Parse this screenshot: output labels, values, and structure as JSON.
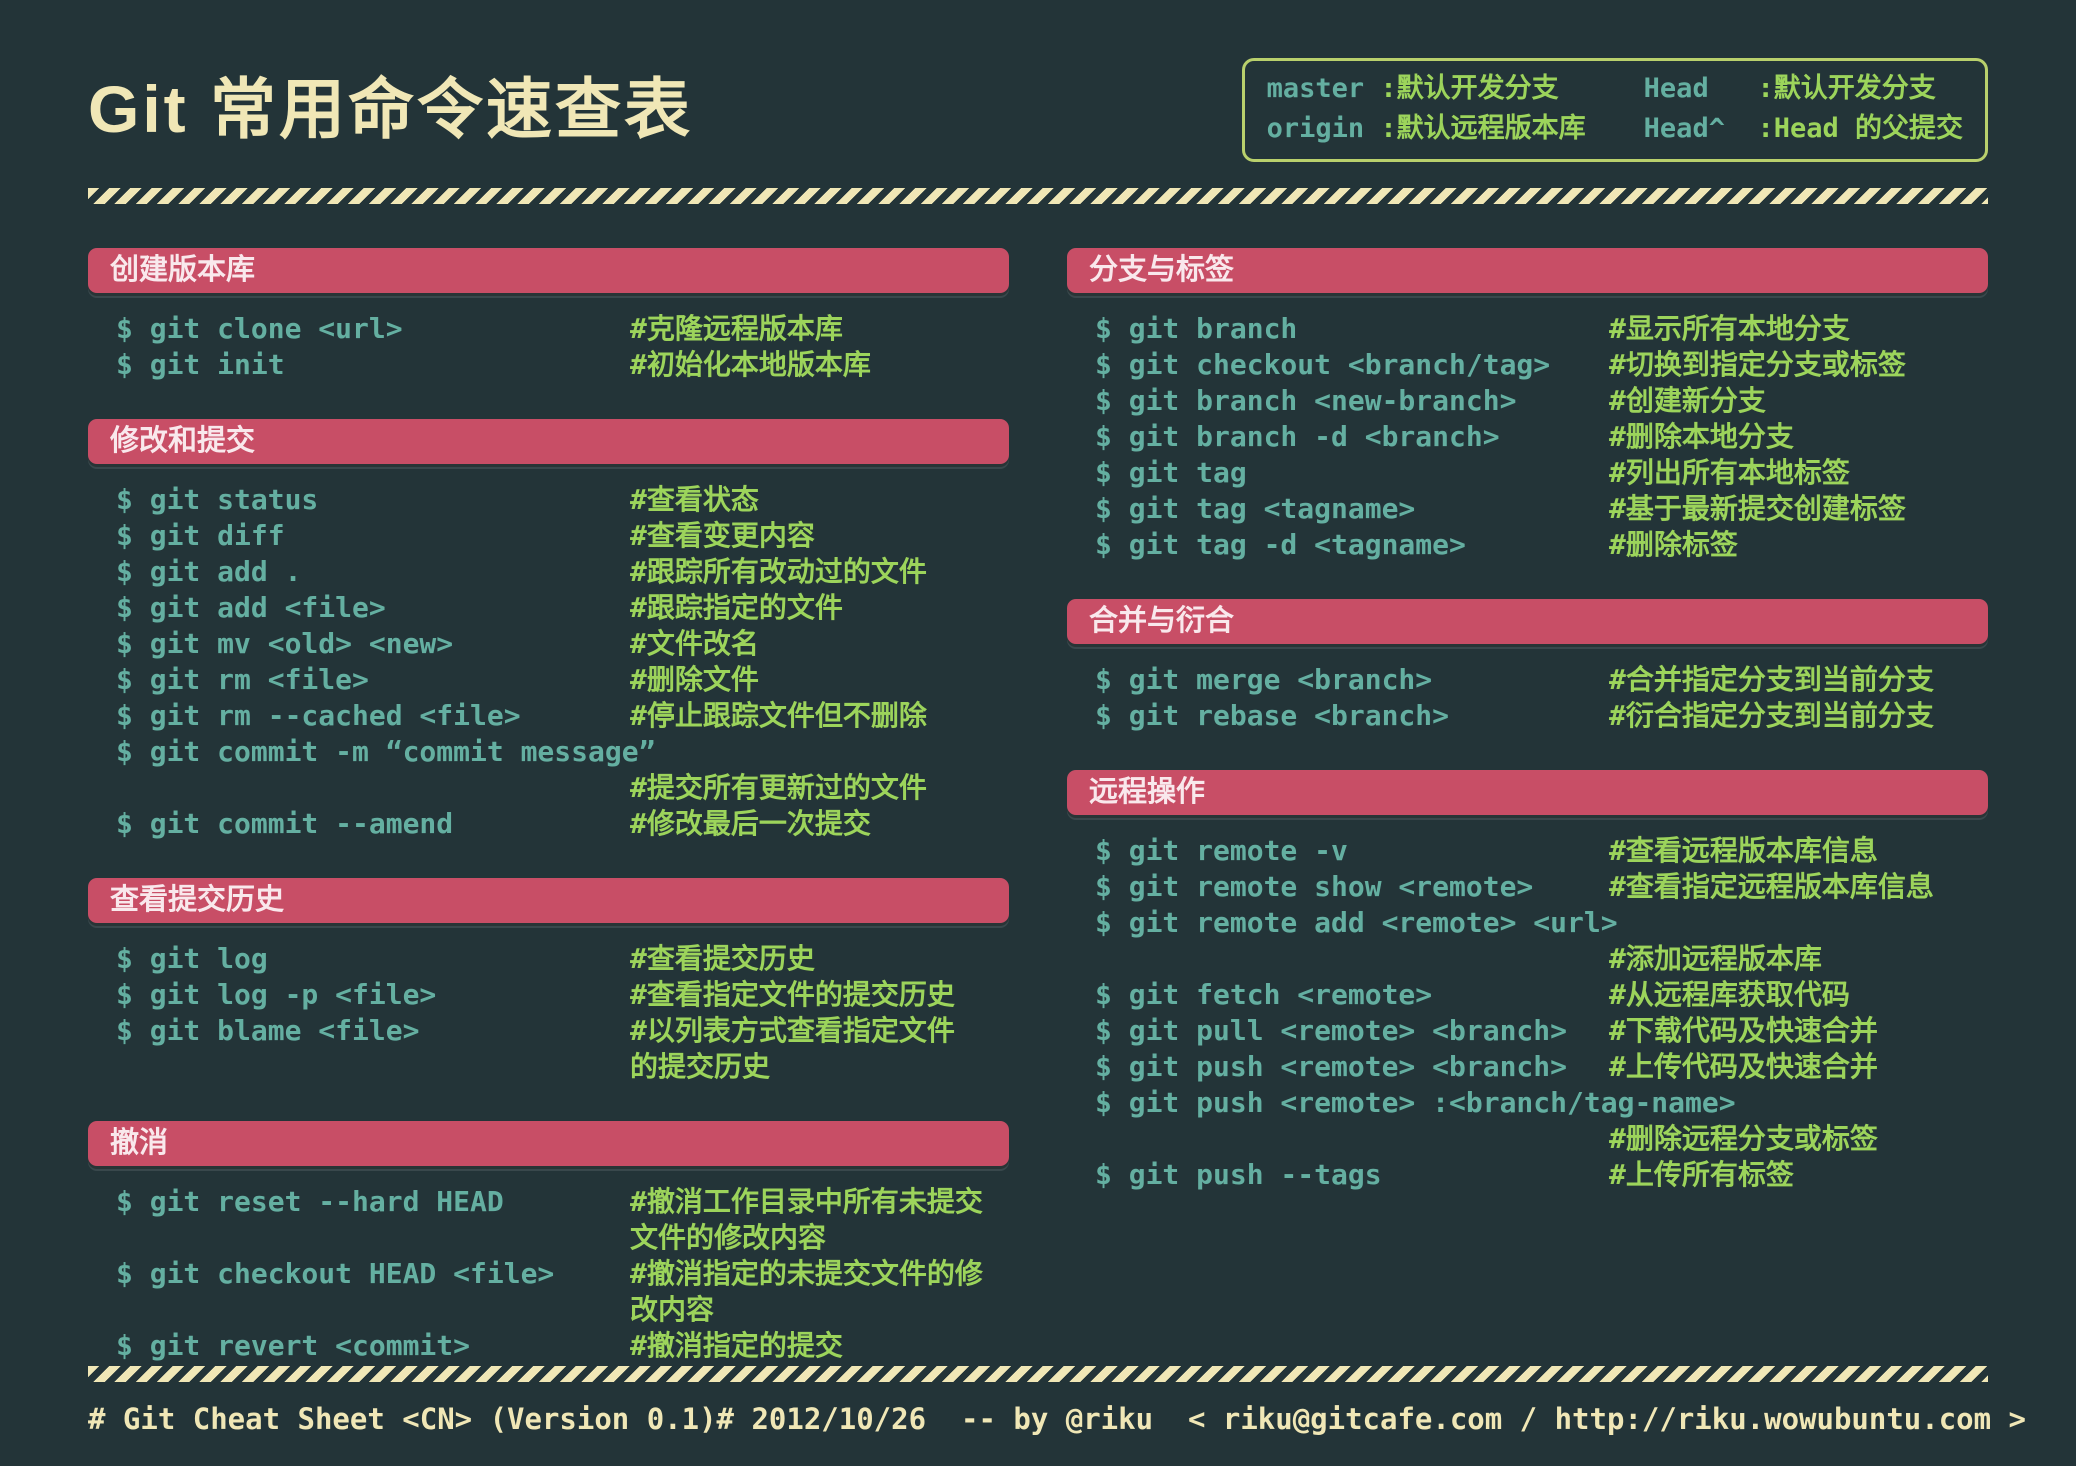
{
  "title": "Git 常用命令速查表",
  "colors": {
    "bg": "#233438",
    "accent": "#C84E66",
    "accent-text": "#F9E8EC",
    "cmd": "#64AFA1",
    "cmt": "#9CD45B",
    "cream": "#F0E7B6",
    "legend-border": "#B9D06C"
  },
  "legend": {
    "columns": [
      [
        {
          "term": "master",
          "desc": ":默认开发分支"
        },
        {
          "term": "origin",
          "desc": ":默认远程版本库"
        }
      ],
      [
        {
          "term": "Head",
          "desc": ":默认开发分支"
        },
        {
          "term": "Head^",
          "desc": ":Head 的父提交"
        }
      ]
    ]
  },
  "columns": [
    {
      "sections": [
        {
          "header": "创建版本库",
          "rows": [
            {
              "cmd": "$ git clone <url>",
              "comment": "#克隆远程版本库"
            },
            {
              "cmd": "$ git init",
              "comment": "#初始化本地版本库"
            }
          ]
        },
        {
          "header": "修改和提交",
          "rows": [
            {
              "cmd": "$ git status",
              "comment": "#查看状态"
            },
            {
              "cmd": "$ git diff",
              "comment": "#查看变更内容"
            },
            {
              "cmd": "$ git add .",
              "comment": "#跟踪所有改动过的文件"
            },
            {
              "cmd": "$ git add <file>",
              "comment": "#跟踪指定的文件"
            },
            {
              "cmd": "$ git mv <old> <new>",
              "comment": "#文件改名"
            },
            {
              "cmd": "$ git rm <file>",
              "comment": "#删除文件"
            },
            {
              "cmd": "$ git rm --cached <file>",
              "comment": "#停止跟踪文件但不删除"
            },
            {
              "cmd": "$ git commit -m “commit message”",
              "comment": "#提交所有更新过的文件",
              "wide": true
            },
            {
              "cmd": "$ git commit --amend",
              "comment": "#修改最后一次提交"
            }
          ]
        },
        {
          "header": "查看提交历史",
          "rows": [
            {
              "cmd": "$ git log",
              "comment": "#查看提交历史"
            },
            {
              "cmd": "$ git log -p <file>",
              "comment": "#查看指定文件的提交历史"
            },
            {
              "cmd": "$ git blame <file>",
              "comment": "#以列表方式查看指定文件\n的提交历史"
            }
          ]
        },
        {
          "header": "撤消",
          "rows": [
            {
              "cmd": "$ git reset --hard HEAD",
              "comment": "#撤消工作目录中所有未提交\n文件的修改内容"
            },
            {
              "cmd": "$ git checkout HEAD <file>",
              "comment": "#撤消指定的未提交文件的修\n改内容"
            },
            {
              "cmd": "$ git revert <commit>",
              "comment": "#撤消指定的提交"
            }
          ]
        }
      ]
    },
    {
      "sections": [
        {
          "header": "分支与标签",
          "rows": [
            {
              "cmd": "$ git branch",
              "comment": "#显示所有本地分支"
            },
            {
              "cmd": "$ git checkout <branch/tag>",
              "comment": "#切换到指定分支或标签"
            },
            {
              "cmd": "$ git branch <new-branch>",
              "comment": "#创建新分支"
            },
            {
              "cmd": "$ git branch -d <branch>",
              "comment": "#删除本地分支"
            },
            {
              "cmd": "$ git tag",
              "comment": "#列出所有本地标签"
            },
            {
              "cmd": "$ git tag <tagname>",
              "comment": "#基于最新提交创建标签"
            },
            {
              "cmd": "$ git tag -d <tagname>",
              "comment": "#删除标签"
            }
          ]
        },
        {
          "header": "合并与衍合",
          "rows": [
            {
              "cmd": "$ git merge <branch>",
              "comment": "#合并指定分支到当前分支"
            },
            {
              "cmd": "$ git rebase <branch>",
              "comment": "#衍合指定分支到当前分支"
            }
          ]
        },
        {
          "header": "远程操作",
          "rows": [
            {
              "cmd": "$ git remote -v",
              "comment": "#查看远程版本库信息"
            },
            {
              "cmd": "$ git remote show <remote>",
              "comment": "#查看指定远程版本库信息"
            },
            {
              "cmd": "$ git remote add <remote> <url>",
              "comment": "#添加远程版本库",
              "wide": true
            },
            {
              "cmd": "$ git fetch <remote>",
              "comment": "#从远程库获取代码"
            },
            {
              "cmd": "$ git pull <remote> <branch>",
              "comment": "#下载代码及快速合并"
            },
            {
              "cmd": "$ git push <remote> <branch>",
              "comment": "#上传代码及快速合并"
            },
            {
              "cmd": "$ git push <remote> :<branch/tag-name>",
              "comment": "#删除远程分支或标签",
              "wide": true
            },
            {
              "cmd": "$ git push --tags",
              "comment": "#上传所有标签"
            }
          ]
        }
      ]
    }
  ],
  "footer": {
    "left": "# Git Cheat Sheet <CN> (Version 0.1)",
    "right": "# 2012/10/26  -- by @riku  < riku@gitcafe.com / http://riku.wowubuntu.com >"
  }
}
